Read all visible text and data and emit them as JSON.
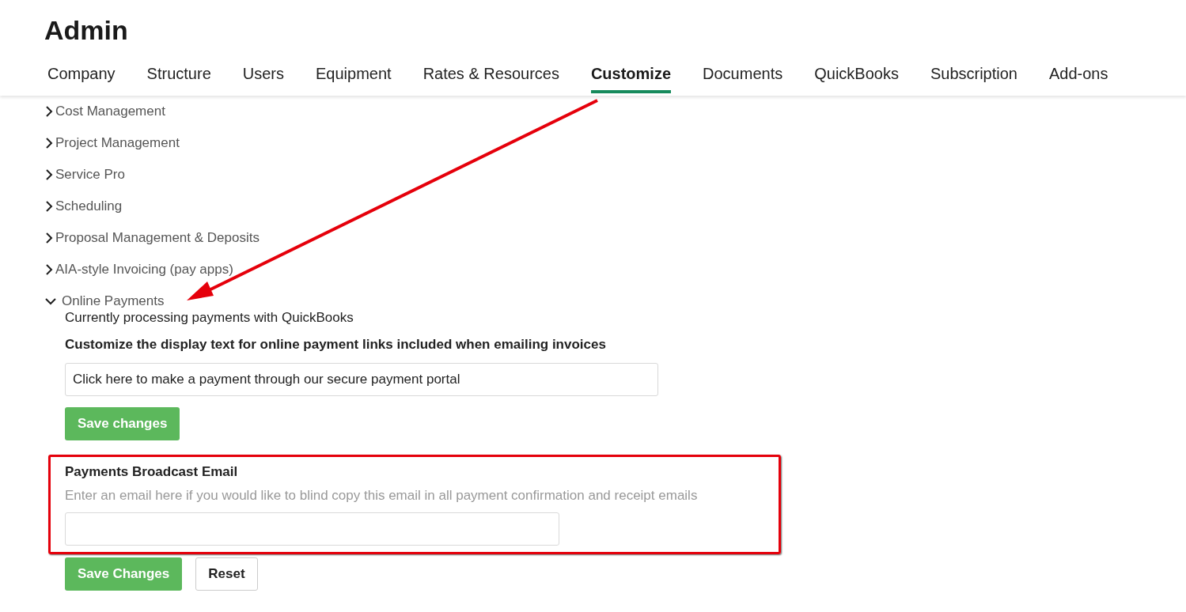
{
  "page_title": "Admin",
  "tabs": [
    {
      "label": "Company",
      "selected": false
    },
    {
      "label": "Structure",
      "selected": false
    },
    {
      "label": "Users",
      "selected": false
    },
    {
      "label": "Equipment",
      "selected": false
    },
    {
      "label": "Rates & Resources",
      "selected": false
    },
    {
      "label": "Customize",
      "selected": true
    },
    {
      "label": "Documents",
      "selected": false
    },
    {
      "label": "QuickBooks",
      "selected": false
    },
    {
      "label": "Subscription",
      "selected": false
    },
    {
      "label": "Add-ons",
      "selected": false
    }
  ],
  "sections": [
    {
      "label": "Cost Management",
      "expanded": false
    },
    {
      "label": "Project Management",
      "expanded": false
    },
    {
      "label": "Service Pro",
      "expanded": false
    },
    {
      "label": "Scheduling",
      "expanded": false
    },
    {
      "label": "Proposal Management & Deposits",
      "expanded": false
    },
    {
      "label": "AIA-style Invoicing (pay apps)",
      "expanded": false
    },
    {
      "label": "Online Payments",
      "expanded": true
    }
  ],
  "online_payments": {
    "status": "Currently processing payments with QuickBooks",
    "link_text_label": "Customize the display text for online payment links included when emailing invoices",
    "link_text_value": "Click here to make a payment through our secure payment portal",
    "save_button": "Save changes",
    "broadcast": {
      "title": "Payments Broadcast Email",
      "hint": "Enter an email here if you would like to blind copy this email in all payment confirmation and receipt emails"
    },
    "buttons": [
      {
        "label": "Save Changes",
        "kind": "primary"
      },
      {
        "label": "Reset",
        "kind": "secondary"
      }
    ]
  }
}
